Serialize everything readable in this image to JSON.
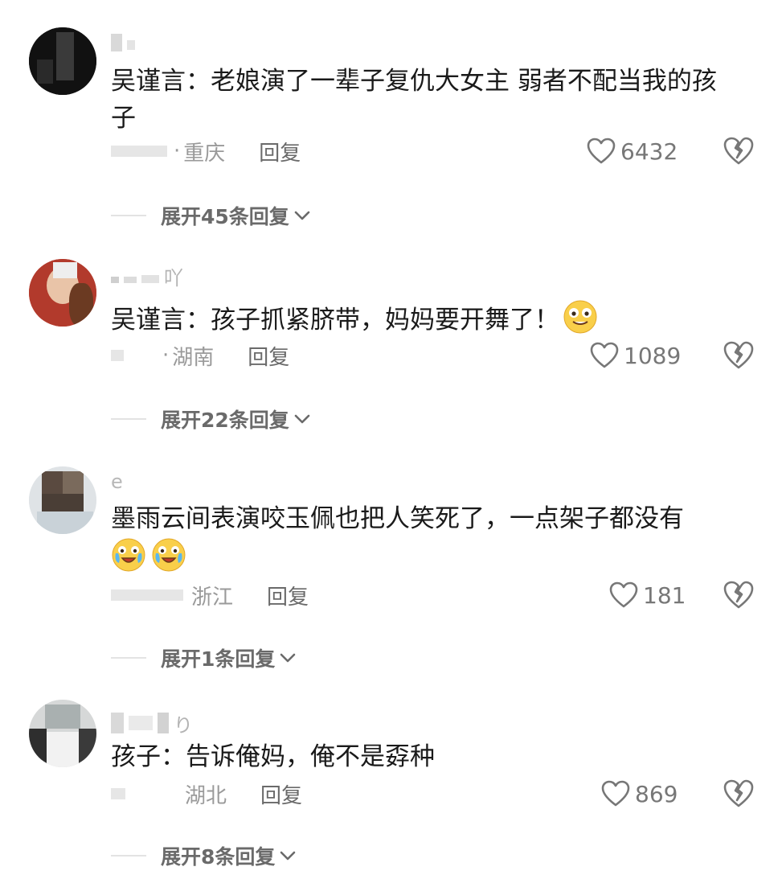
{
  "comments": [
    {
      "username": "",
      "text": "吴谨言：老娘演了一辈子复仇大女主 弱者不配当我的孩子",
      "location": "重庆",
      "reply_label": "回复",
      "likes": "6432",
      "expand_label": "展开45条回复"
    },
    {
      "username": "吖",
      "text": "吴谨言：孩子抓紧脐带，妈妈要开舞了！",
      "location": "湖南",
      "reply_label": "回复",
      "likes": "1089",
      "expand_label": "展开22条回复"
    },
    {
      "username": "e",
      "text": "墨雨云间表演咬玉佩也把人笑死了，一点架子都没有",
      "location": "浙江",
      "reply_label": "回复",
      "likes": "181",
      "expand_label": "展开1条回复"
    },
    {
      "username": "り",
      "text": "孩子：告诉俺妈，俺不是孬种",
      "location": "湖北",
      "reply_label": "回复",
      "likes": "869",
      "expand_label": "展开8条回复"
    }
  ]
}
